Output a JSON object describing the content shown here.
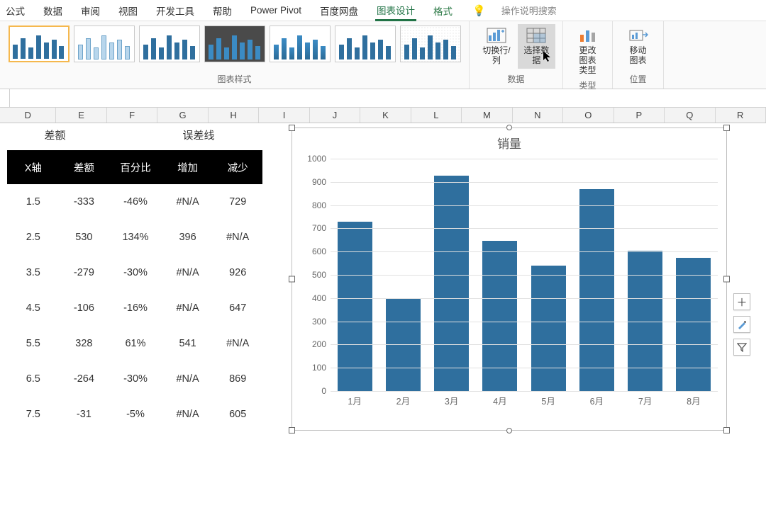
{
  "tabs": [
    "公式",
    "数据",
    "审阅",
    "视图",
    "开发工具",
    "帮助",
    "Power Pivot",
    "百度网盘",
    "图表设计",
    "格式"
  ],
  "tabs_active_index": 8,
  "search_placeholder": "操作说明搜索",
  "ribbon": {
    "group_styles": "图表样式",
    "group_data": "数据",
    "group_type": "类型",
    "group_pos": "位置",
    "btn_switch": "切换行/列",
    "btn_select": "选择数据",
    "btn_changetype": "更改\n图表类型",
    "btn_move": "移动图表"
  },
  "columns": [
    "D",
    "E",
    "F",
    "G",
    "H",
    "I",
    "J",
    "K",
    "L",
    "M",
    "N",
    "O",
    "P",
    "Q",
    "R"
  ],
  "label_row": {
    "diff": "差额",
    "errbar": "误差线"
  },
  "table": {
    "headers": [
      "X轴",
      "差额",
      "百分比",
      "增加",
      "减少"
    ],
    "rows": [
      [
        "1.5",
        "-333",
        "-46%",
        "#N/A",
        "729"
      ],
      [
        "2.5",
        "530",
        "134%",
        "396",
        "#N/A"
      ],
      [
        "3.5",
        "-279",
        "-30%",
        "#N/A",
        "926"
      ],
      [
        "4.5",
        "-106",
        "-16%",
        "#N/A",
        "647"
      ],
      [
        "5.5",
        "328",
        "61%",
        "541",
        "#N/A"
      ],
      [
        "6.5",
        "-264",
        "-30%",
        "#N/A",
        "869"
      ],
      [
        "7.5",
        "-31",
        "-5%",
        "#N/A",
        "605"
      ]
    ]
  },
  "chart_data": {
    "type": "bar",
    "title": "销量",
    "categories": [
      "1月",
      "2月",
      "3月",
      "4月",
      "5月",
      "6月",
      "7月",
      "8月"
    ],
    "values": [
      729,
      396,
      926,
      647,
      541,
      869,
      605,
      574
    ],
    "ylim": [
      0,
      1000
    ],
    "ytick_step": 100,
    "xlabel": "",
    "ylabel": ""
  },
  "side_buttons": [
    "+",
    "brush",
    "filter"
  ]
}
